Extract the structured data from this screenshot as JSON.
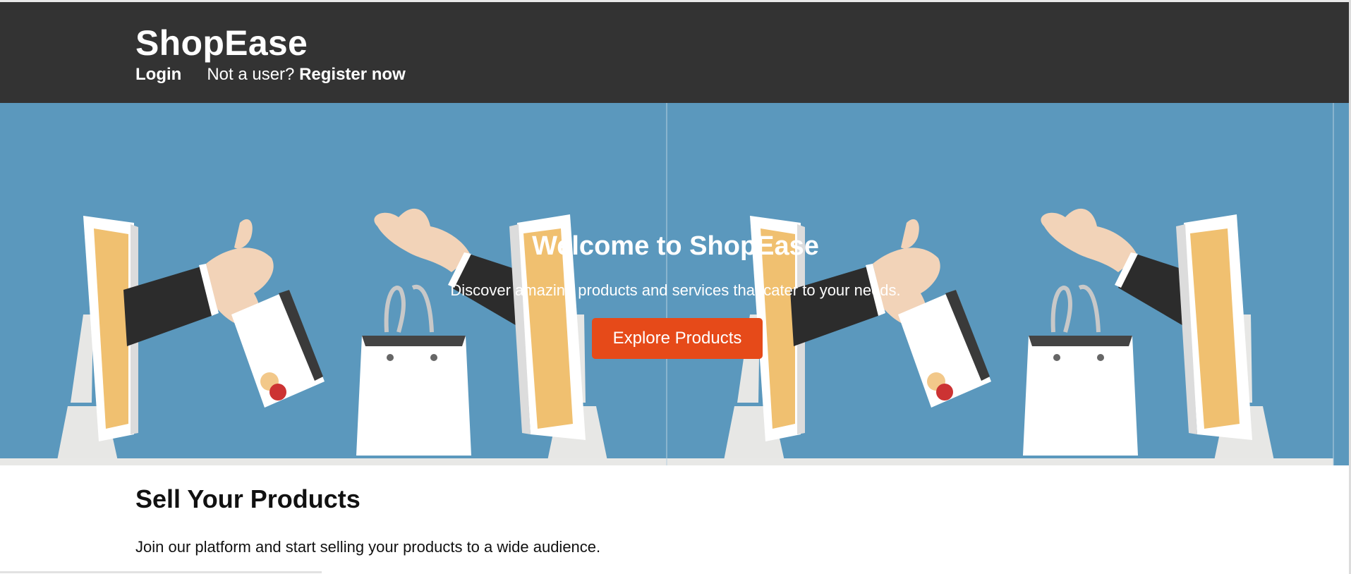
{
  "brand": "ShopEase",
  "auth": {
    "login": "Login",
    "prompt": "Not a user?",
    "register": "Register now"
  },
  "hero": {
    "title": "Welcome to ShopEase",
    "subtitle": "Discover amazing products and services that cater to your needs.",
    "cta": "Explore Products"
  },
  "sell": {
    "title": "Sell Your Products",
    "text": "Join our platform and start selling your products to a wide audience."
  },
  "colors": {
    "header_bg": "#333333",
    "hero_bg": "#5b98bd",
    "cta_bg": "#e64a19",
    "sleeve": "#2c2c2c",
    "hand": "#f2d3b8",
    "screen": "#f0c070"
  },
  "illustration": {
    "icons": [
      "monitor-icon",
      "hand-credit-card-icon",
      "hand-shopping-bag-icon"
    ]
  }
}
